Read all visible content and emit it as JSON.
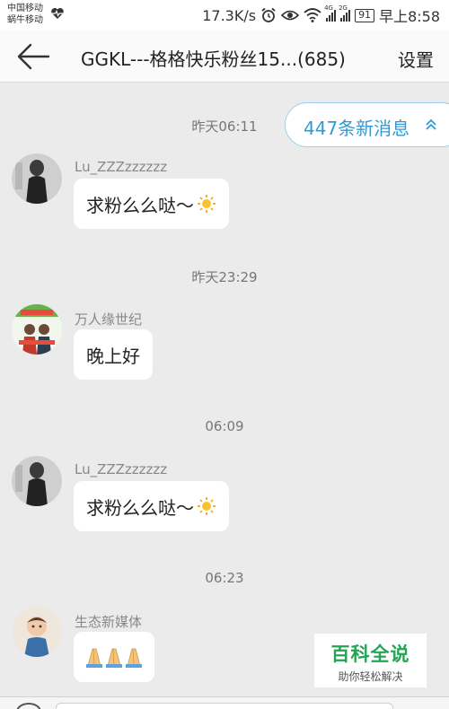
{
  "status_bar": {
    "carrier_1": "中国移动",
    "carrier_2": "蜗牛移动",
    "speed": "17.3K/s",
    "net_4g": "4G",
    "net_2g": "2G",
    "battery": "91",
    "time": "早上8:58"
  },
  "header": {
    "title": "GGKL---格格快乐粉丝15...(685)",
    "settings_label": "设置"
  },
  "new_messages_pill": {
    "label": "447条新消息"
  },
  "messages": [
    {
      "timestamp": "昨天06:11",
      "sender": "Lu_ZZZzzzzzz",
      "text": "求粉么么哒～",
      "emoji": "sun-emoji"
    },
    {
      "timestamp": "昨天23:29",
      "sender": "万人缘世纪",
      "text": "晚上好"
    },
    {
      "timestamp": "06:09",
      "sender": "Lu_ZZZzzzzzz",
      "text": "求粉么么哒～",
      "emoji": "sun-emoji"
    },
    {
      "timestamp": "06:23",
      "sender": "生态新媒体",
      "emoji": "praying-hands-emoji x3"
    }
  ],
  "watermark": {
    "title": "百科全说",
    "subtitle": "助你轻松解决"
  },
  "colors": {
    "accent_blue": "#2f9ad6",
    "watermark_green": "#23a554",
    "chat_background": "#ebebeb"
  }
}
